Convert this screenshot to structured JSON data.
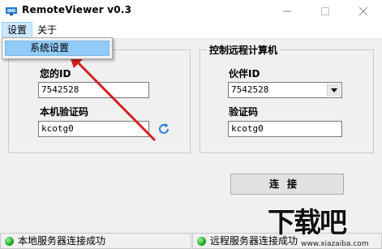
{
  "window": {
    "title": "RemoteViewer v0.3"
  },
  "menu": {
    "settings": "设置",
    "about": "关于",
    "dropdown_item": "系统设置"
  },
  "local_group": {
    "id_label": "您的ID",
    "id_value": "7542528",
    "code_label": "本机验证码",
    "code_value": "kcotg0"
  },
  "remote_group": {
    "title": "控制远程计算机",
    "partner_label": "伙伴ID",
    "partner_value": "7542528",
    "code_label": "验证码",
    "code_value": "kcotg0",
    "connect_label": "连接"
  },
  "status": {
    "local": "本地服务器连接成功",
    "remote": "远程服务器连接成功"
  },
  "watermark": {
    "logo": "下载吧",
    "url": "www.xiazaiba.com"
  },
  "colors": {
    "accent": "#2a7fd4",
    "status_ok": "#1fa51f",
    "arrow": "#d42020"
  }
}
